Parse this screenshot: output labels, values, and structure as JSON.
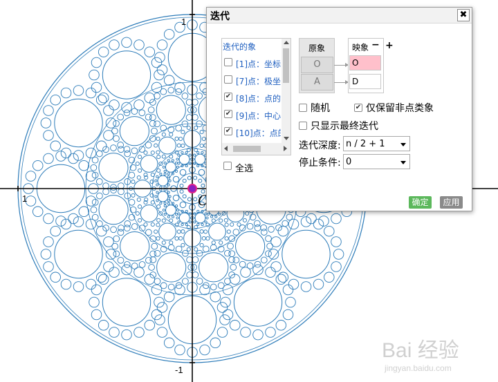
{
  "canvas": {
    "axis_labels": {
      "y_top": "1",
      "x_left": "1",
      "y_bottom": "-1"
    },
    "origin_label": "O",
    "colors": {
      "circle": "#2a7ab8",
      "axis": "#000000",
      "origin_point": "#e0208a",
      "origin_fill": "#8b1fc0"
    }
  },
  "dialog": {
    "title": "迭代",
    "close_icon": "close-icon",
    "list": {
      "header": "迭代的象",
      "items": [
        {
          "label": "[1]点：坐标",
          "checked": false
        },
        {
          "label": "[7]点：极坐",
          "checked": false
        },
        {
          "label": "[8]点：点的",
          "checked": true
        },
        {
          "label": "[9]点：中心",
          "checked": true
        },
        {
          "label": "[10]点：点的",
          "checked": true
        }
      ]
    },
    "select_all": "全选",
    "source_header": "原象",
    "source_points": [
      "O",
      "A"
    ],
    "image_header": "映象",
    "image_minus": "−",
    "image_plus": "+",
    "image_points": [
      {
        "value": "O",
        "highlight": "#ffc0cb"
      },
      {
        "value": "D",
        "highlight": "#ffffff"
      }
    ],
    "options": {
      "random": "随机",
      "random_checked": false,
      "keep_non_point": "仅保留非点类象",
      "keep_non_point_checked": true,
      "final_only": "只显示最终迭代",
      "final_only_checked": false
    },
    "depth_label": "迭代深度:",
    "depth_value": "n / 2 + 1",
    "stop_label": "停止条件:",
    "stop_value": "0",
    "ok_button": "确定",
    "apply_button": "应用"
  },
  "watermark": {
    "text": "Bai 经验",
    "sub": "jingyan.baidu.com"
  }
}
